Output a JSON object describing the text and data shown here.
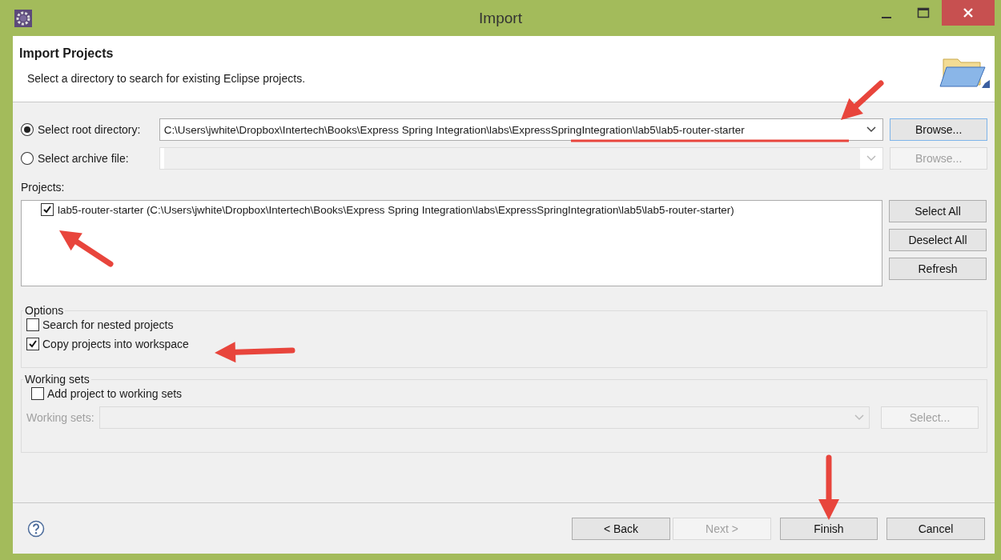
{
  "window": {
    "title": "Import"
  },
  "header": {
    "title": "Import Projects",
    "description": "Select a directory to search for existing Eclipse projects."
  },
  "sources": [
    {
      "label": "Select root directory:",
      "selected": true,
      "value": "C:\\Users\\jwhite\\Dropbox\\Intertech\\Books\\Express Spring Integration\\labs\\ExpressSpringIntegration\\lab5\\lab5-router-starter",
      "button": {
        "label": "Browse...",
        "disabled": false
      }
    },
    {
      "label": "Select archive file:",
      "selected": false,
      "button": {
        "label": "Browse...",
        "disabled": true
      }
    }
  ],
  "projects": {
    "label": "Projects:",
    "items": [
      {
        "label": "lab5-router-starter (C:\\Users\\jwhite\\Dropbox\\Intertech\\Books\\Express Spring Integration\\labs\\ExpressSpringIntegration\\lab5\\lab5-router-starter)",
        "checked": true
      }
    ],
    "buttons": [
      {
        "label": "Select All"
      },
      {
        "label": "Deselect All"
      },
      {
        "label": "Refresh"
      }
    ]
  },
  "options": {
    "title": "Options",
    "items": [
      {
        "label": "Search for nested projects",
        "checked": false
      },
      {
        "label": "Copy projects into workspace",
        "checked": true
      }
    ]
  },
  "working_sets": {
    "title": "Working sets",
    "checkbox": {
      "label": "Add project to working sets",
      "checked": false
    },
    "field_label": "Working sets:",
    "disabled": true,
    "button": {
      "label": "Select..."
    }
  },
  "footer": {
    "buttons": [
      {
        "label": "< Back",
        "disabled": false
      },
      {
        "label": "Next >",
        "disabled": true
      },
      {
        "label": "Finish",
        "disabled": false
      },
      {
        "label": "Cancel",
        "disabled": false
      }
    ]
  }
}
